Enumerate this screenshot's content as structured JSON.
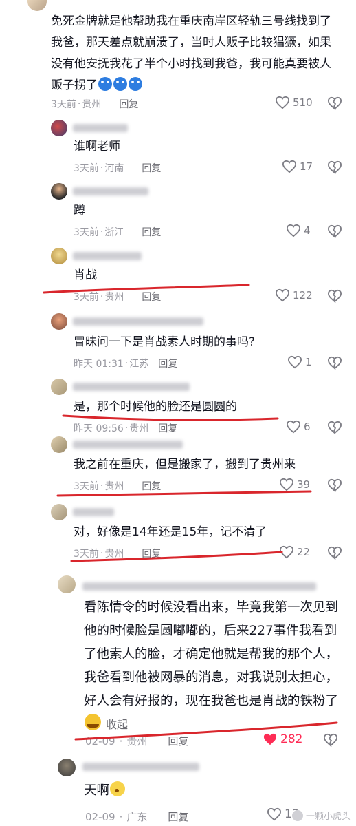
{
  "comments": [
    {
      "text_before": "免死金牌就是他帮助我在重庆南岸区轻轨三号线找到了我爸，那天差点就崩溃了，当时人贩子比较猖獗，如果没有他安抚我花了半个小时找到我爸，我可能真要被人贩子拐了",
      "time": "3天前",
      "loc": "贵州",
      "reply": "回复",
      "likes": "510"
    },
    {
      "text": "谁啊老师",
      "time": "3天前",
      "loc": "河南",
      "reply": "回复",
      "likes": "17"
    },
    {
      "text": "蹲",
      "time": "3天前",
      "loc": "浙江",
      "reply": "回复",
      "likes": "4"
    },
    {
      "text": "肖战",
      "time": "3天前",
      "loc": "贵州",
      "reply": "回复",
      "likes": "122"
    },
    {
      "text": "冒昧问一下是肖战素人时期的事吗?",
      "time": "昨天 01:31",
      "loc": "江苏",
      "reply": "回复",
      "likes": "1"
    },
    {
      "text": "是，那个时候他的脸还是圆圆的",
      "time": "昨天 09:56",
      "loc": "贵州",
      "reply": "回复",
      "likes": "6"
    },
    {
      "text": "我之前在重庆，但是搬家了，搬到了贵州来",
      "time": "3天前",
      "loc": "贵州",
      "reply": "回复",
      "likes": "39"
    },
    {
      "text": "对，好像是14年还是15年，记不清了",
      "time": "3天前",
      "loc": "贵州",
      "reply": "回复",
      "likes": "22"
    },
    {
      "text_before": "看陈情令的时候没看出来，毕竟我第一次见到他的时候脸是圆嘟嘟的，后来227事件我看到了他素人的脸，才确定他就是帮我的那个人，我爸看到他被网暴的消息，对我说别太担心，好人会有好报的，现在我爸也是肖战的铁粉了",
      "fold": "收起",
      "time": "02-09",
      "loc": "贵州",
      "reply": "回复",
      "likes": "282"
    },
    {
      "text": "天啊",
      "time": "02-09",
      "loc": "广东",
      "reply": "回复",
      "likes": "13"
    }
  ],
  "loc_sep": "·",
  "watermark": "一颗小虎头",
  "colors": {
    "liked": "#fe2c55",
    "annotation_line": "#d9262c"
  },
  "icons": {
    "like": "heart-outline-icon",
    "liked": "heart-filled-icon",
    "dislike": "broken-heart-icon"
  }
}
